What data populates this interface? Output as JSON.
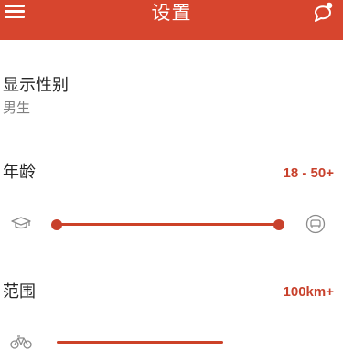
{
  "header": {
    "title": "设置",
    "bg_color": "#d7452e",
    "menu_icon": "hamburger-menu-icon",
    "chat_icon": "chat-bubble-icon"
  },
  "gender": {
    "label": "显示性别",
    "value": "男生"
  },
  "age": {
    "label": "年龄",
    "range_text": "18 - 50+",
    "min_icon": "graduation-cap-icon",
    "max_icon": "armchair-icon"
  },
  "distance": {
    "label": "范围",
    "value_text": "100km+",
    "icon": "bicycle-icon"
  },
  "accent_color": "#c8412c"
}
